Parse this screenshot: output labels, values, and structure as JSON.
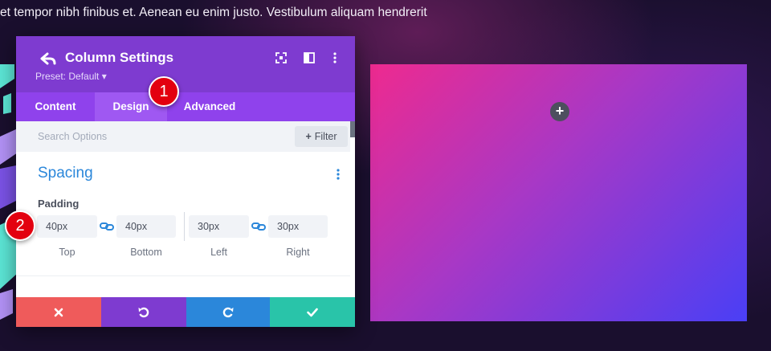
{
  "background": {
    "paragraph": "et tempor nibh finibus et. Aenean eu enim justo. Vestibulum aliquam hendrerit"
  },
  "modal": {
    "title": "Column Settings",
    "preset": "Preset: Default ▾",
    "tabs": [
      {
        "label": "Content"
      },
      {
        "label": "Design"
      },
      {
        "label": "Advanced"
      }
    ],
    "active_tab": "Design",
    "search": {
      "placeholder": "Search Options",
      "filter_label": "Filter",
      "filter_icon": "+"
    },
    "section": {
      "title": "Spacing"
    },
    "padding": {
      "label": "Padding",
      "fields": [
        {
          "value": "40px",
          "label": "Top"
        },
        {
          "value": "40px",
          "label": "Bottom"
        },
        {
          "value": "30px",
          "label": "Left"
        },
        {
          "value": "30px",
          "label": "Right"
        }
      ]
    }
  },
  "callouts": [
    "1",
    "2"
  ],
  "colors": {
    "header": "#7e3bd0",
    "tabs": "#8f42ec",
    "accent_blue": "#2b87da",
    "cancel": "#ef5b5b",
    "undo": "#7e3bd0",
    "redo": "#2b87da",
    "save": "#29c4a9"
  }
}
